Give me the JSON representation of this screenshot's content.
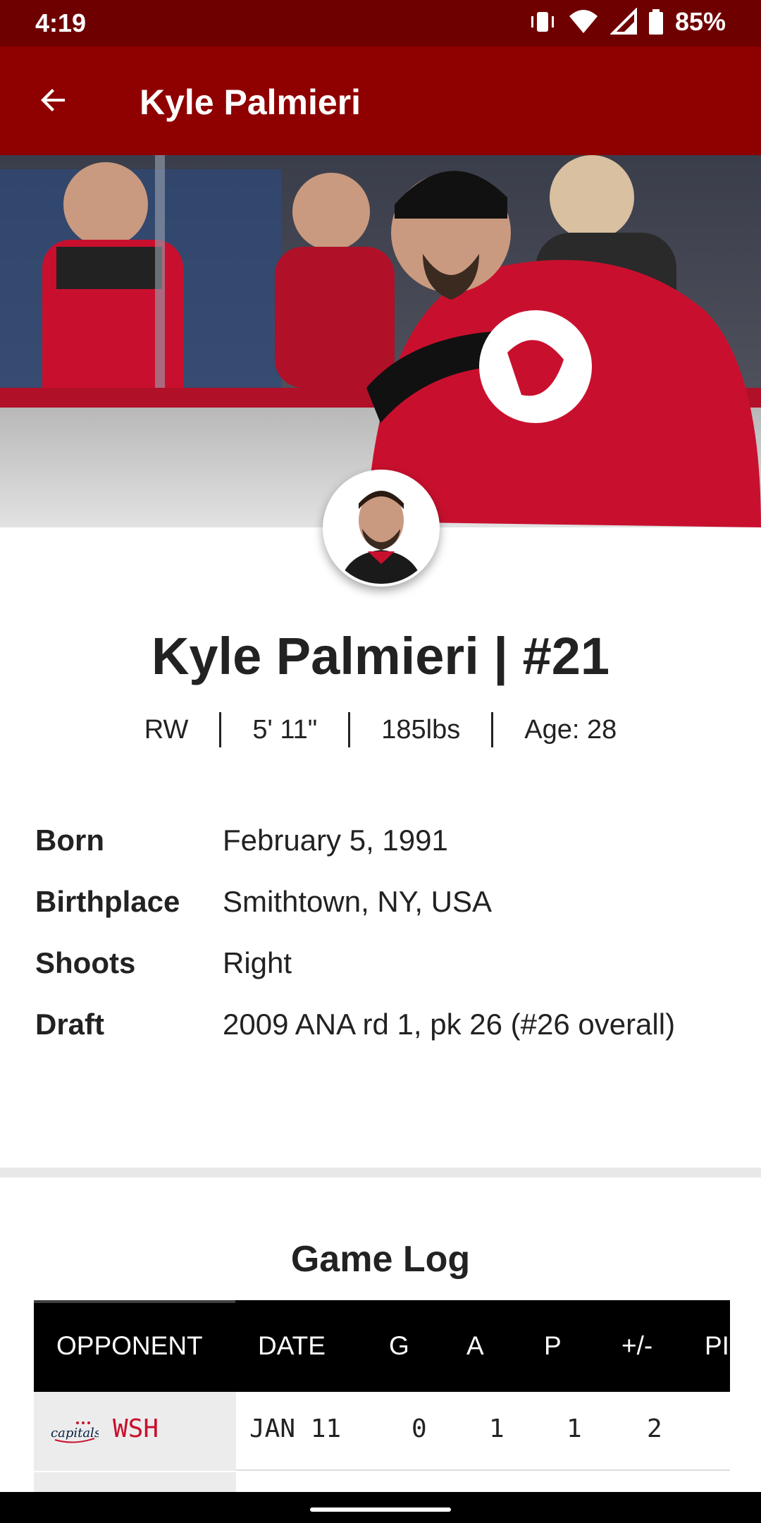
{
  "status_bar": {
    "time": "4:19",
    "battery": "85%",
    "icons": [
      "vibrate-icon",
      "wifi-icon",
      "cell-signal-icon",
      "battery-icon"
    ]
  },
  "app_bar": {
    "title": "Kyle Palmieri",
    "back_icon": "arrow-back-icon"
  },
  "player": {
    "name_number": "Kyle Palmieri | #21",
    "vitals": [
      "RW",
      "5' 11\"",
      "185lbs",
      "Age: 28"
    ],
    "bio": [
      {
        "key": "Born",
        "value": "February 5, 1991"
      },
      {
        "key": "Birthplace",
        "value": "Smithtown, NY, USA"
      },
      {
        "key": "Shoots",
        "value": "Right"
      },
      {
        "key": "Draft",
        "value": "2009 ANA rd 1, pk 26 (#26 overall)"
      }
    ]
  },
  "game_log": {
    "title": "Game Log",
    "headers": [
      "OPPONENT",
      "DATE",
      "G",
      "A",
      "P",
      "+/-",
      "PI"
    ],
    "rows": [
      {
        "logo": "capitals-logo",
        "opponent": "WSH",
        "date": "JAN 11",
        "g": "0",
        "a": "1",
        "p": "1",
        "plus_minus": "2"
      }
    ]
  },
  "colors": {
    "status_bar": "#6f0000",
    "app_bar": "#8f0000",
    "opponent_text": "#c8102e"
  }
}
